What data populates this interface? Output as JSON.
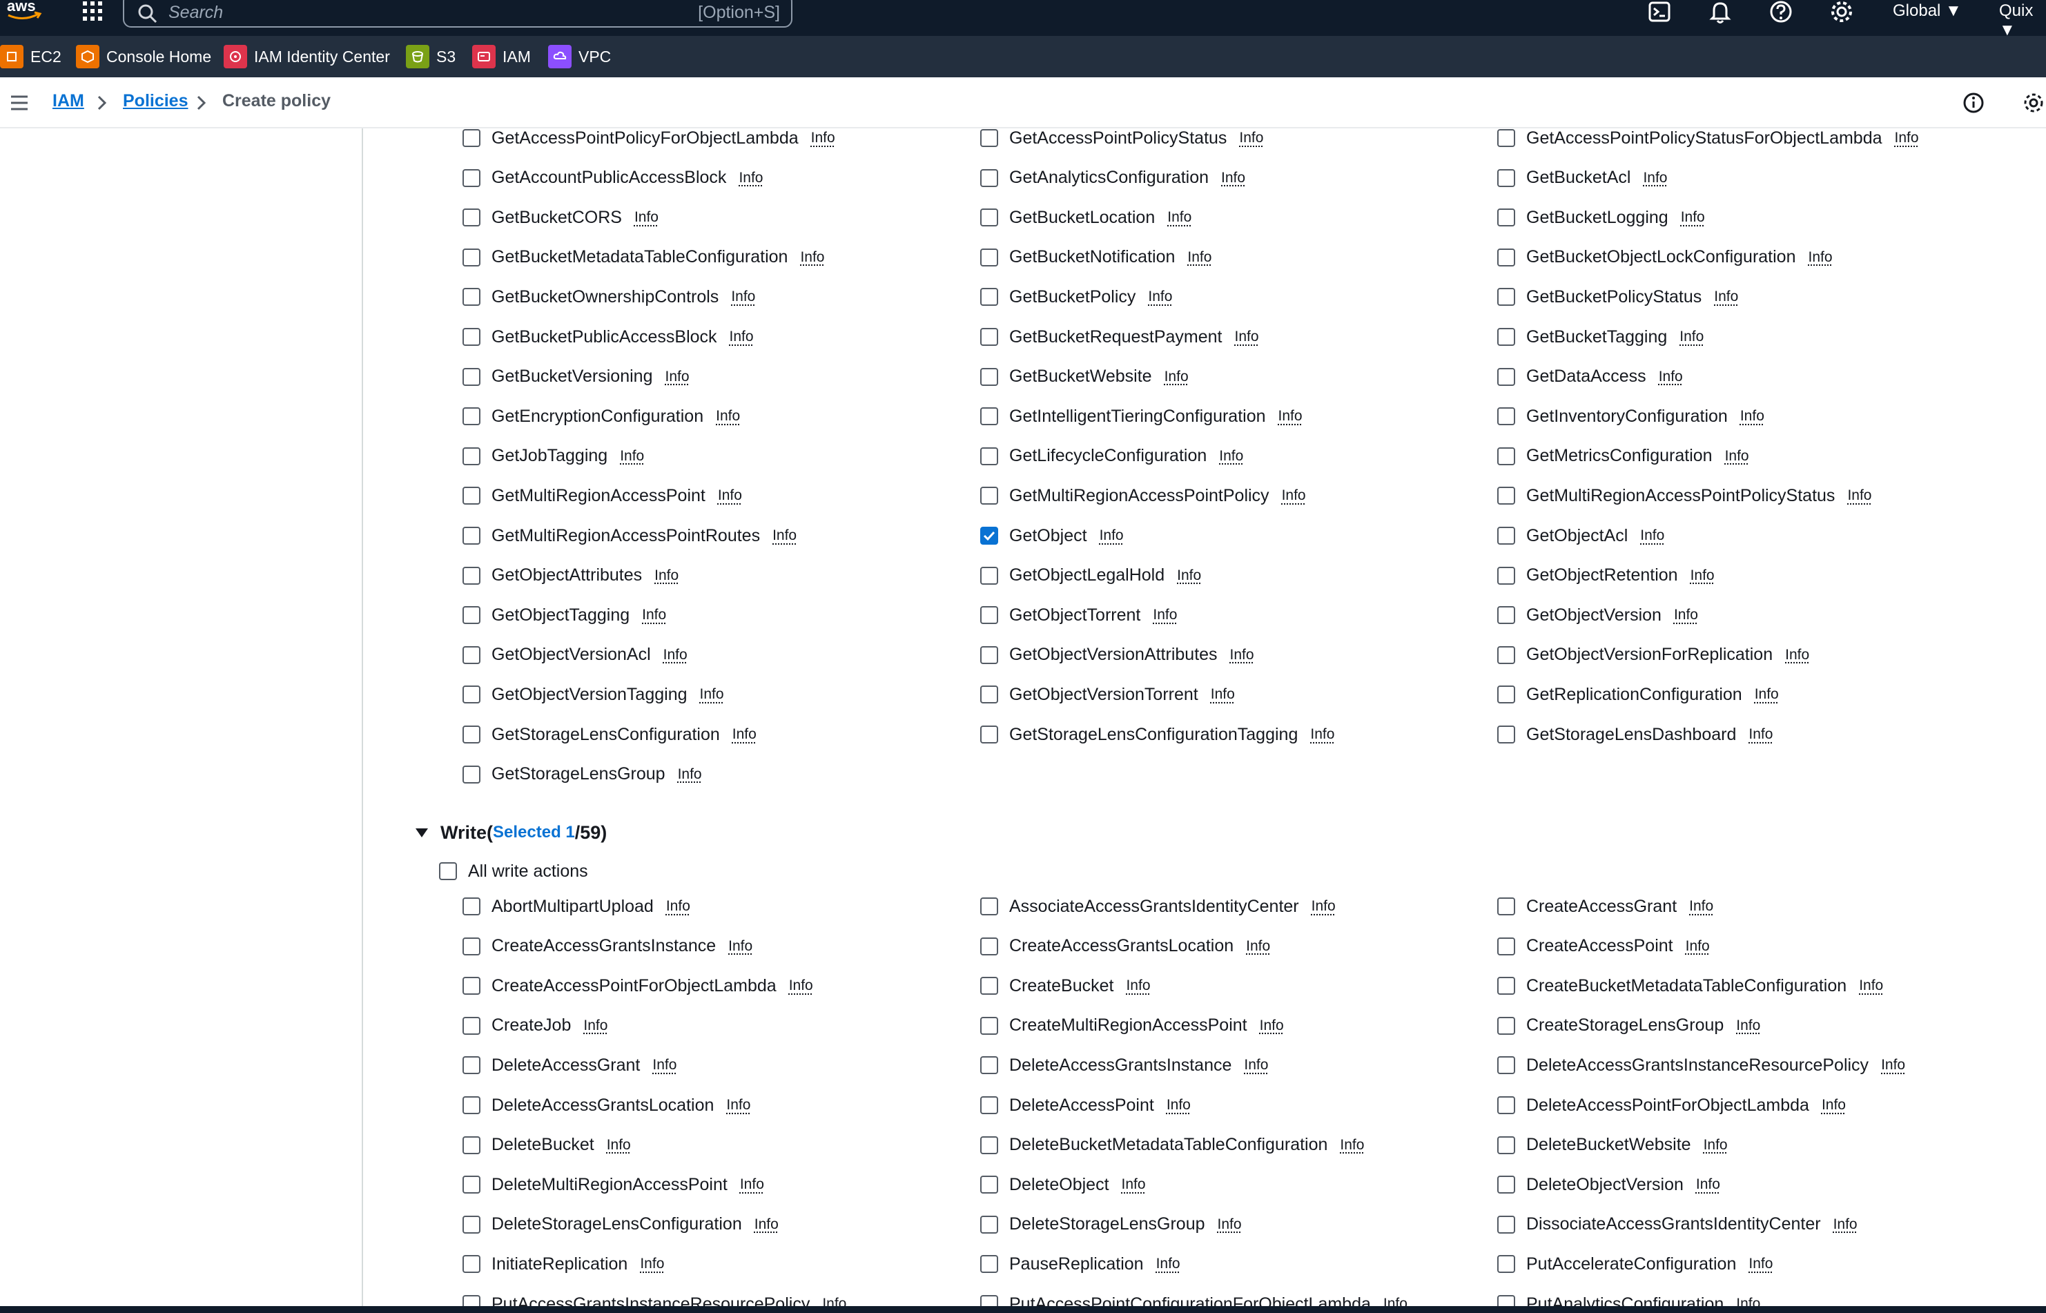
{
  "topbar": {
    "search_placeholder": "Search",
    "search_shortcut": "[Option+S]",
    "region": "Global",
    "user": "Quix"
  },
  "favorites": [
    {
      "label": "EC2",
      "icon": "ec2-icon",
      "color": "#ed7100"
    },
    {
      "label": "Console Home",
      "icon": "console-home-icon",
      "color": "#ed7100"
    },
    {
      "label": "IAM Identity Center",
      "icon": "iam-identity-center-icon",
      "color": "#dd344c"
    },
    {
      "label": "S3",
      "icon": "s3-icon",
      "color": "#7aa116"
    },
    {
      "label": "IAM",
      "icon": "iam-icon",
      "color": "#dd344c"
    },
    {
      "label": "VPC",
      "icon": "vpc-icon",
      "color": "#8c4fff"
    }
  ],
  "breadcrumb": {
    "iam": "IAM",
    "policies": "Policies",
    "current": "Create policy"
  },
  "read_actions": [
    [
      "GetAccessPointPolicyForObjectLambda",
      "GetAccessPointPolicyStatus",
      "GetAccessPointPolicyStatusForObjectLambda"
    ],
    [
      "GetAccountPublicAccessBlock",
      "GetAnalyticsConfiguration",
      "GetBucketAcl"
    ],
    [
      "GetBucketCORS",
      "GetBucketLocation",
      "GetBucketLogging"
    ],
    [
      "GetBucketMetadataTableConfiguration",
      "GetBucketNotification",
      "GetBucketObjectLockConfiguration"
    ],
    [
      "GetBucketOwnershipControls",
      "GetBucketPolicy",
      "GetBucketPolicyStatus"
    ],
    [
      "GetBucketPublicAccessBlock",
      "GetBucketRequestPayment",
      "GetBucketTagging"
    ],
    [
      "GetBucketVersioning",
      "GetBucketWebsite",
      "GetDataAccess"
    ],
    [
      "GetEncryptionConfiguration",
      "GetIntelligentTieringConfiguration",
      "GetInventoryConfiguration"
    ],
    [
      "GetJobTagging",
      "GetLifecycleConfiguration",
      "GetMetricsConfiguration"
    ],
    [
      "GetMultiRegionAccessPoint",
      "GetMultiRegionAccessPointPolicy",
      "GetMultiRegionAccessPointPolicyStatus"
    ],
    [
      "GetMultiRegionAccessPointRoutes",
      "GetObject",
      "GetObjectAcl"
    ],
    [
      "GetObjectAttributes",
      "GetObjectLegalHold",
      "GetObjectRetention"
    ],
    [
      "GetObjectTagging",
      "GetObjectTorrent",
      "GetObjectVersion"
    ],
    [
      "GetObjectVersionAcl",
      "GetObjectVersionAttributes",
      "GetObjectVersionForReplication"
    ],
    [
      "GetObjectVersionTagging",
      "GetObjectVersionTorrent",
      "GetReplicationConfiguration"
    ],
    [
      "GetStorageLensConfiguration",
      "GetStorageLensConfigurationTagging",
      "GetStorageLensDashboard"
    ],
    [
      "GetStorageLensGroup"
    ]
  ],
  "checked_actions": [
    "GetObject"
  ],
  "info_label": "Info",
  "write_section": {
    "title": "Write",
    "open_paren": " (",
    "selected_text": "Selected 1",
    "total_text": "/59)",
    "all_label": "All write actions"
  },
  "write_actions": [
    [
      "AbortMultipartUpload",
      "AssociateAccessGrantsIdentityCenter",
      "CreateAccessGrant"
    ],
    [
      "CreateAccessGrantsInstance",
      "CreateAccessGrantsLocation",
      "CreateAccessPoint"
    ],
    [
      "CreateAccessPointForObjectLambda",
      "CreateBucket",
      "CreateBucketMetadataTableConfiguration"
    ],
    [
      "CreateJob",
      "CreateMultiRegionAccessPoint",
      "CreateStorageLensGroup"
    ],
    [
      "DeleteAccessGrant",
      "DeleteAccessGrantsInstance",
      "DeleteAccessGrantsInstanceResourcePolicy"
    ],
    [
      "DeleteAccessGrantsLocation",
      "DeleteAccessPoint",
      "DeleteAccessPointForObjectLambda"
    ],
    [
      "DeleteBucket",
      "DeleteBucketMetadataTableConfiguration",
      "DeleteBucketWebsite"
    ],
    [
      "DeleteMultiRegionAccessPoint",
      "DeleteObject",
      "DeleteObjectVersion"
    ],
    [
      "DeleteStorageLensConfiguration",
      "DeleteStorageLensGroup",
      "DissociateAccessGrantsIdentityCenter"
    ],
    [
      "InitiateReplication",
      "PauseReplication",
      "PutAccelerateConfiguration"
    ],
    [
      "PutAccessGrantsInstanceResourcePolicy",
      "PutAccessPointConfigurationForObjectLambda",
      "PutAnalyticsConfiguration"
    ]
  ]
}
